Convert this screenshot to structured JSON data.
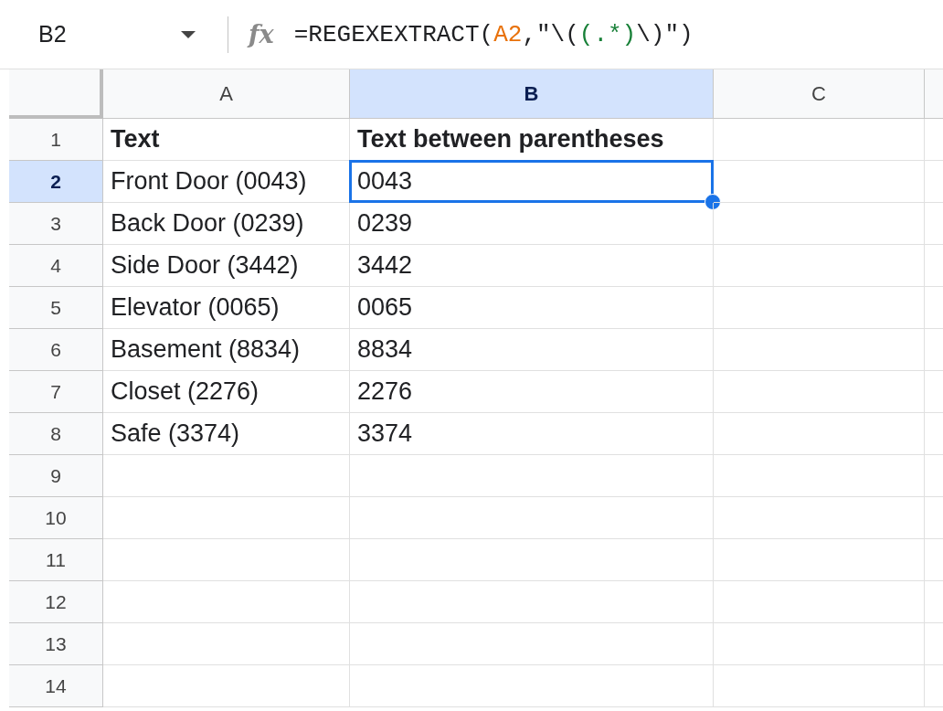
{
  "formula_bar": {
    "name_box": "B2",
    "fx": "fx",
    "formula": [
      {
        "text": "=REGEXEXTRACT(",
        "color": "#202124"
      },
      {
        "text": "A2",
        "color": "#e8710a"
      },
      {
        "text": ",\"\\(",
        "color": "#202124"
      },
      {
        "text": "(.*)",
        "color": "#188038"
      },
      {
        "text": "\\)\")",
        "color": "#202124"
      }
    ]
  },
  "columns": [
    {
      "label": "A",
      "selected": false
    },
    {
      "label": "B",
      "selected": true
    },
    {
      "label": "C",
      "selected": false
    }
  ],
  "rows": [
    {
      "label": "1",
      "selected": false,
      "bold": true,
      "cells": [
        {
          "text": "Text",
          "selected": false
        },
        {
          "text": "Text between parentheses",
          "selected": false
        }
      ]
    },
    {
      "label": "2",
      "selected": true,
      "bold": false,
      "cells": [
        {
          "text": "Front Door (0043)",
          "selected": false
        },
        {
          "text": "0043",
          "selected": true
        }
      ]
    },
    {
      "label": "3",
      "selected": false,
      "bold": false,
      "cells": [
        {
          "text": "Back Door (0239)",
          "selected": false
        },
        {
          "text": "0239",
          "selected": false
        }
      ]
    },
    {
      "label": "4",
      "selected": false,
      "bold": false,
      "cells": [
        {
          "text": "Side Door (3442)",
          "selected": false
        },
        {
          "text": "3442",
          "selected": false
        }
      ]
    },
    {
      "label": "5",
      "selected": false,
      "bold": false,
      "cells": [
        {
          "text": "Elevator (0065)",
          "selected": false
        },
        {
          "text": "0065",
          "selected": false
        }
      ]
    },
    {
      "label": "6",
      "selected": false,
      "bold": false,
      "cells": [
        {
          "text": "Basement (8834)",
          "selected": false
        },
        {
          "text": "8834",
          "selected": false
        }
      ]
    },
    {
      "label": "7",
      "selected": false,
      "bold": false,
      "cells": [
        {
          "text": "Closet (2276)",
          "selected": false
        },
        {
          "text": "2276",
          "selected": false
        }
      ]
    },
    {
      "label": "8",
      "selected": false,
      "bold": false,
      "cells": [
        {
          "text": "Safe (3374)",
          "selected": false
        },
        {
          "text": "3374",
          "selected": false
        }
      ]
    },
    {
      "label": "9",
      "selected": false,
      "cells": []
    },
    {
      "label": "10",
      "selected": false,
      "cells": []
    },
    {
      "label": "11",
      "selected": false,
      "cells": []
    },
    {
      "label": "12",
      "selected": false,
      "cells": []
    },
    {
      "label": "13",
      "selected": false,
      "cells": []
    },
    {
      "label": "14",
      "selected": false,
      "cells": []
    }
  ]
}
